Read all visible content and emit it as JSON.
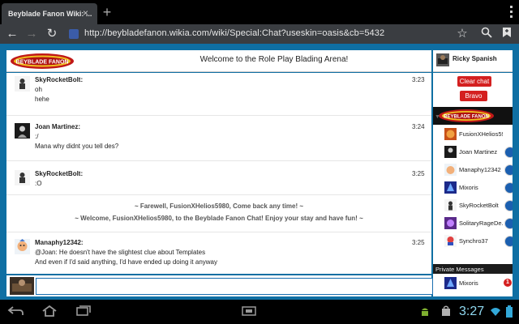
{
  "browser": {
    "tab_title": "Beyblade Fanon Wiki: ...",
    "tab_close_glyph": "×",
    "new_tab_glyph": "+",
    "menu_glyph": "⋮",
    "url": "http://beybladefanon.wikia.com/wiki/Special:Chat?useskin=oasis&cb=5432",
    "back_glyph": "←",
    "forward_glyph": "→",
    "reload_glyph": "↻",
    "star_glyph": "☆",
    "search_glyph": "⌕",
    "bookmarks_glyph": "▮"
  },
  "chat": {
    "header_title": "Welcome to the Role Play Blading Arena!",
    "logo_text": "BEYBLADE FANON",
    "current_user": "Ricky Spanish",
    "messages": [
      {
        "name": "SkyRocketBolt:",
        "time": "3:23",
        "lines": [
          "oh",
          "hehe"
        ]
      },
      {
        "name": "Joan Martinez:",
        "time": "3:24",
        "lines": [
          ":/",
          "Mana why didnt you tell des?"
        ]
      },
      {
        "name": "SkyRocketBolt:",
        "time": "3:25",
        "lines": [
          ":O"
        ]
      },
      {
        "name": "Manaphy12342:",
        "time": "3:25",
        "lines": [
          "@Joan: He doesn't have the slightest clue about Templates",
          "And even if I'd said anything, I'd have ended up doing it anyway"
        ]
      }
    ],
    "inline_alerts": [
      "~ Farewell, FusionXHelios5980, Come back any time! ~",
      "~ Welcome, FusionXHelios5980, to the Beyblade Fanon Chat! Enjoy your stay and have fun! ~"
    ]
  },
  "sidebar": {
    "clear_chat_label": "Clear chat",
    "bravo_label": "Bravo",
    "users": [
      {
        "name": "FusionXHelios5980"
      },
      {
        "name": "Joan Martinez"
      },
      {
        "name": "Manaphy12342"
      },
      {
        "name": "Mixoris"
      },
      {
        "name": "SkyRocketBolt"
      },
      {
        "name": "SolitaryRageDe..."
      },
      {
        "name": "Synchro37"
      }
    ],
    "pm_header": "Private Messages",
    "pm_user": "Mixoris",
    "pm_badge": "1"
  },
  "system": {
    "clock": "3:27",
    "back_glyph": "◁",
    "home_glyph": "⌂",
    "recents_glyph": "▭"
  },
  "colors": {
    "page_bg": "#0f6fa3",
    "button_red": "#d42020",
    "clock_blue": "#8fd8f0"
  }
}
